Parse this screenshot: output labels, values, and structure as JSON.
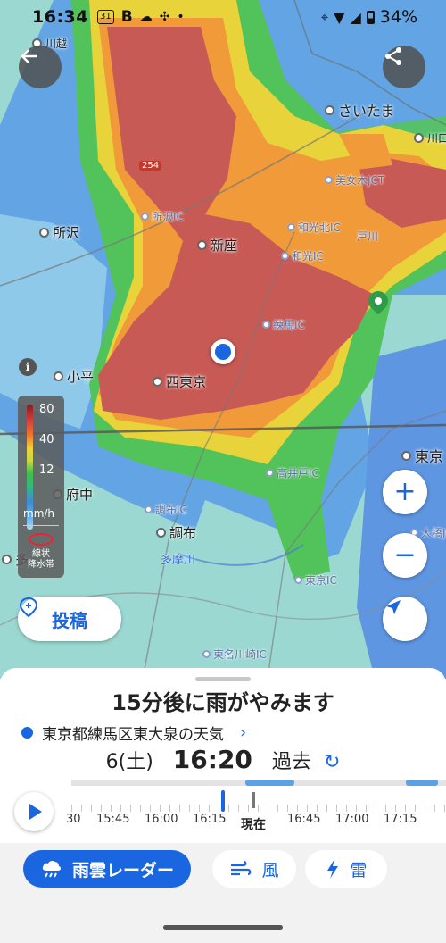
{
  "status_bar": {
    "time": "16:34",
    "calendar_badge": "31",
    "b_label": "B",
    "battery": "34%"
  },
  "map": {
    "places": [
      {
        "name": "所沢"
      },
      {
        "name": "新座"
      },
      {
        "name": "小平"
      },
      {
        "name": "西東京"
      },
      {
        "name": "府中"
      },
      {
        "name": "調布"
      },
      {
        "name": "さいたま"
      },
      {
        "name": "東京"
      },
      {
        "name": "多"
      },
      {
        "name": "川越"
      },
      {
        "name": "川口"
      }
    ],
    "ics": [
      {
        "name": "所沢IC"
      },
      {
        "name": "和光北IC"
      },
      {
        "name": "和光IC"
      },
      {
        "name": "練馬IC"
      },
      {
        "name": "美女木JCT"
      },
      {
        "name": "高井戸IC"
      },
      {
        "name": "調布IC"
      },
      {
        "name": "東京IC"
      },
      {
        "name": "東名川崎IC"
      },
      {
        "name": "大橋JC"
      },
      {
        "name": "戸川"
      }
    ],
    "river_label": "多摩川",
    "route_number": "254",
    "legend": {
      "ticks": [
        "80",
        "40",
        "12"
      ],
      "unit": "mm/h",
      "band_label_1": "線状",
      "band_label_2": "降水帯"
    },
    "post_button": "投稿",
    "zoom_in": "+",
    "zoom_out": "−"
  },
  "panel": {
    "headline": "15分後に雨がやみます",
    "location": "東京都練馬区東大泉の天気",
    "day": "6(土)",
    "time": "16:20",
    "mode": "過去",
    "timeline": {
      "labels": [
        "30",
        "15:45",
        "16:00",
        "16:15",
        "16:45",
        "17:00",
        "17:15"
      ],
      "now_label": "現在"
    },
    "tabs": [
      {
        "label": "雨雲レーダー",
        "icon": "rain-cloud-icon",
        "active": true
      },
      {
        "label": "風",
        "icon": "wind-icon",
        "active": false
      },
      {
        "label": "雷",
        "icon": "lightning-icon",
        "active": false
      }
    ]
  }
}
